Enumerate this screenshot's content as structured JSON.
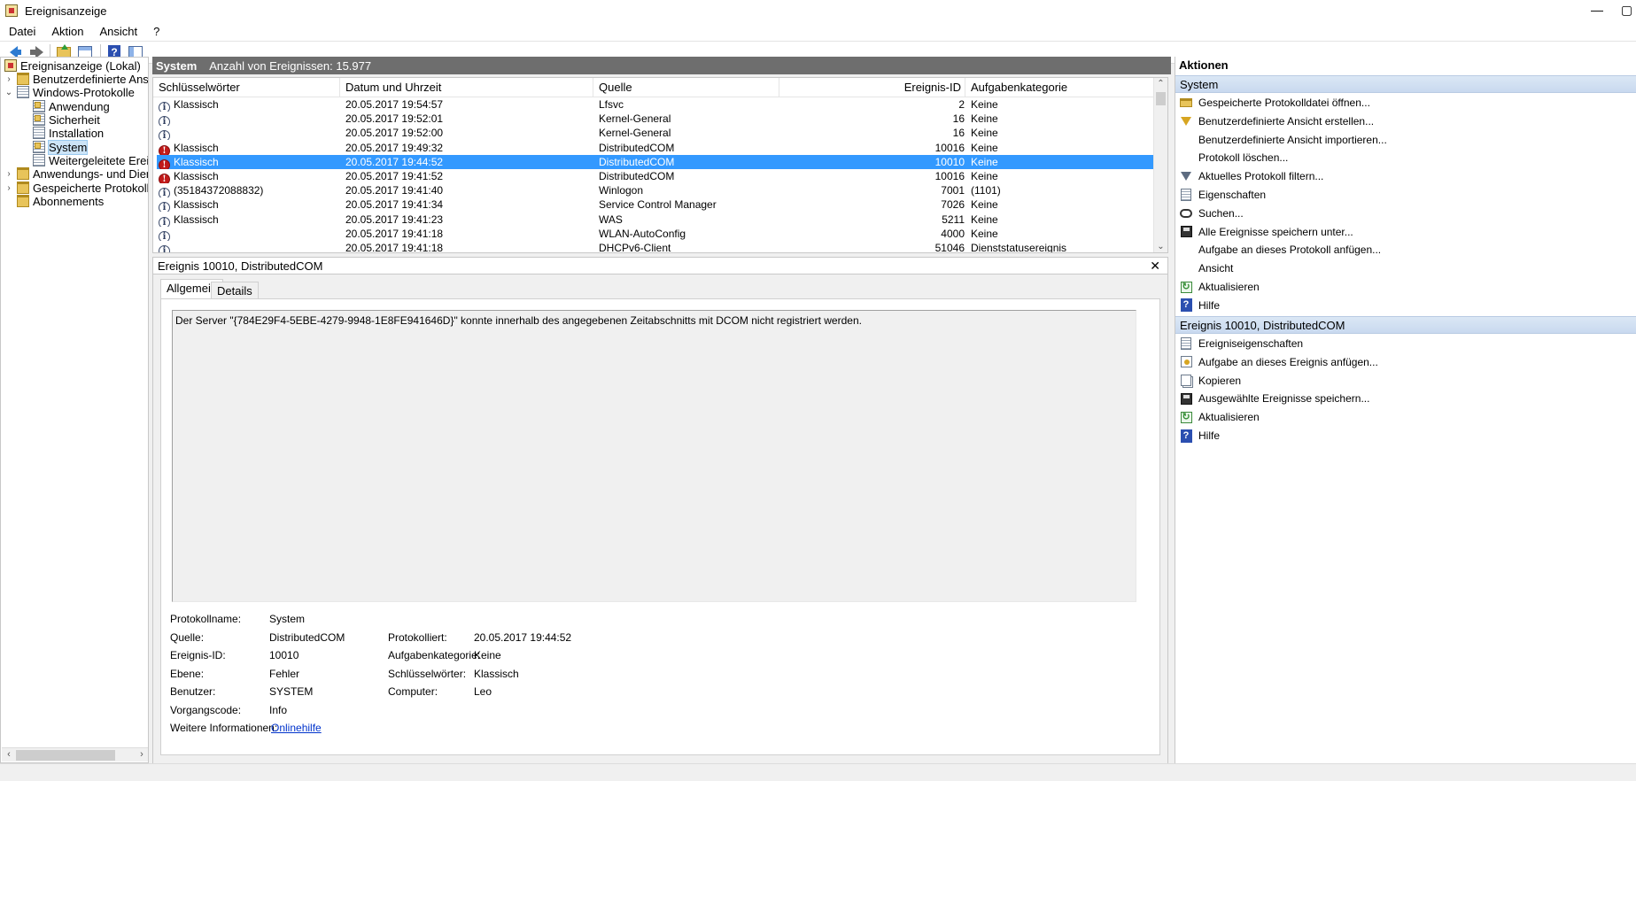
{
  "window": {
    "title": "Ereignisanzeige",
    "minimize_glyph": "—",
    "restore_glyph": "▢"
  },
  "menu": [
    "Datei",
    "Aktion",
    "Ansicht",
    "?"
  ],
  "toolbar": {
    "icons": [
      "back-icon",
      "forward-icon",
      "folder-up-icon",
      "show-hide-tree-icon",
      "help-icon",
      "show-hide-action-pane-icon"
    ]
  },
  "tree": {
    "root": "Ereignisanzeige (Lokal)",
    "custom_views": "Benutzerdefinierte Ansichten",
    "windows_logs": "Windows-Protokolle",
    "logs": [
      "Anwendung",
      "Sicherheit",
      "Installation",
      "System",
      "Weitergeleitete Ereignisse"
    ],
    "apps_services": "Anwendungs- und Dienstprotokolle",
    "saved_logs": "Gespeicherte Protokolle",
    "subscriptions": "Abonnements",
    "selected": "System"
  },
  "center": {
    "log_name": "System",
    "event_count": "Anzahl von Ereignissen: 15.977"
  },
  "grid": {
    "columns": [
      "Schlüsselwörter",
      "Datum und Uhrzeit",
      "Quelle",
      "Ereignis-ID",
      "Aufgabenkategorie"
    ],
    "rows": [
      {
        "level": "info",
        "keywords": "Klassisch",
        "date": "20.05.2017 19:54:57",
        "source": "Lfsvc",
        "id": "2",
        "category": "Keine"
      },
      {
        "level": "info",
        "keywords": "",
        "date": "20.05.2017 19:52:01",
        "source": "Kernel-General",
        "id": "16",
        "category": "Keine"
      },
      {
        "level": "info",
        "keywords": "",
        "date": "20.05.2017 19:52:00",
        "source": "Kernel-General",
        "id": "16",
        "category": "Keine"
      },
      {
        "level": "error",
        "keywords": "Klassisch",
        "date": "20.05.2017 19:49:32",
        "source": "DistributedCOM",
        "id": "10016",
        "category": "Keine"
      },
      {
        "level": "error",
        "keywords": "Klassisch",
        "date": "20.05.2017 19:44:52",
        "source": "DistributedCOM",
        "id": "10010",
        "category": "Keine",
        "selected": true
      },
      {
        "level": "error",
        "keywords": "Klassisch",
        "date": "20.05.2017 19:41:52",
        "source": "DistributedCOM",
        "id": "10016",
        "category": "Keine"
      },
      {
        "level": "info",
        "keywords": "(35184372088832)",
        "date": "20.05.2017 19:41:40",
        "source": "Winlogon",
        "id": "7001",
        "category": "(1101)"
      },
      {
        "level": "info",
        "keywords": "Klassisch",
        "date": "20.05.2017 19:41:34",
        "source": "Service Control Manager",
        "id": "7026",
        "category": "Keine"
      },
      {
        "level": "info",
        "keywords": "Klassisch",
        "date": "20.05.2017 19:41:23",
        "source": "WAS",
        "id": "5211",
        "category": "Keine"
      },
      {
        "level": "info",
        "keywords": "",
        "date": "20.05.2017 19:41:18",
        "source": "WLAN-AutoConfig",
        "id": "4000",
        "category": "Keine"
      },
      {
        "level": "info",
        "keywords": "",
        "date": "20.05.2017 19:41:18",
        "source": "DHCPv6-Client",
        "id": "51046",
        "category": "Dienststatusereignis"
      }
    ]
  },
  "detail": {
    "title": "Ereignis 10010, DistributedCOM",
    "close_glyph": "✕",
    "tabs": [
      "Allgemein",
      "Details"
    ],
    "message": "Der Server \"{784E29F4-5EBE-4279-9948-1E8FE941646D}\" konnte innerhalb des angegebenen Zeitabschnitts mit DCOM nicht registriert werden.",
    "labels": {
      "log_name": "Protokollname:",
      "source": "Quelle:",
      "event_id": "Ereignis-ID:",
      "level": "Ebene:",
      "user": "Benutzer:",
      "opcode": "Vorgangscode:",
      "more_info": "Weitere Informationen:",
      "logged": "Protokolliert:",
      "task_category": "Aufgabenkategorie:",
      "keywords": "Schlüsselwörter:",
      "computer": "Computer:"
    },
    "values": {
      "log_name": "System",
      "source": "DistributedCOM",
      "event_id": "10010",
      "level": "Fehler",
      "user": "SYSTEM",
      "opcode": "Info",
      "more_info": "Onlinehilfe",
      "logged": "20.05.2017 19:44:52",
      "task_category": "Keine",
      "keywords": "Klassisch",
      "computer": "Leo"
    }
  },
  "actions": {
    "header": "Aktionen",
    "section1": "System",
    "items1": [
      {
        "icon": "open-log-icon",
        "label": "Gespeicherte Protokolldatei öffnen..."
      },
      {
        "icon": "create-view-icon",
        "label": "Benutzerdefinierte Ansicht erstellen..."
      },
      {
        "icon": "",
        "label": "Benutzerdefinierte Ansicht importieren..."
      },
      {
        "icon": "",
        "label": "Protokoll löschen..."
      },
      {
        "icon": "filter-icon",
        "label": "Aktuelles Protokoll filtern..."
      },
      {
        "icon": "properties-icon",
        "label": "Eigenschaften"
      },
      {
        "icon": "search-icon",
        "label": "Suchen..."
      },
      {
        "icon": "save-icon",
        "label": "Alle Ereignisse speichern unter..."
      },
      {
        "icon": "",
        "label": "Aufgabe an dieses Protokoll anfügen..."
      },
      {
        "icon": "",
        "label": "Ansicht"
      },
      {
        "icon": "refresh-icon",
        "label": "Aktualisieren"
      },
      {
        "icon": "help-icon",
        "label": "Hilfe"
      }
    ],
    "section2": "Ereignis 10010, DistributedCOM",
    "items2": [
      {
        "icon": "event-properties-icon",
        "label": "Ereigniseigenschaften"
      },
      {
        "icon": "attach-task-icon",
        "label": "Aufgabe an dieses Ereignis anfügen..."
      },
      {
        "icon": "copy-icon",
        "label": "Kopieren"
      },
      {
        "icon": "save-icon",
        "label": "Ausgewählte Ereignisse speichern..."
      },
      {
        "icon": "refresh-icon",
        "label": "Aktualisieren"
      },
      {
        "icon": "help-icon",
        "label": "Hilfe"
      }
    ]
  }
}
